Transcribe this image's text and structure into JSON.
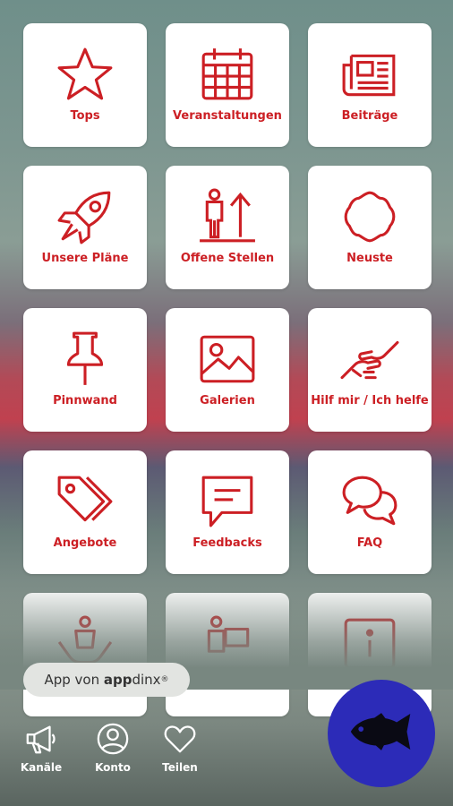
{
  "tiles": [
    {
      "label": "Tops",
      "icon": "star-icon"
    },
    {
      "label": "Veranstaltungen",
      "icon": "calendar-icon"
    },
    {
      "label": "Beiträge",
      "icon": "newspaper-icon"
    },
    {
      "label": "Unsere Pläne",
      "icon": "rocket-icon"
    },
    {
      "label": "Offene Stellen",
      "icon": "career-up-icon"
    },
    {
      "label": "Neuste",
      "icon": "flower-badge-icon"
    },
    {
      "label": "Pinnwand",
      "icon": "pushpin-icon"
    },
    {
      "label": "Galerien",
      "icon": "image-icon"
    },
    {
      "label": "Hilf mir / Ich helfe",
      "icon": "handshake-icon"
    },
    {
      "label": "Angebote",
      "icon": "tags-icon"
    },
    {
      "label": "Feedbacks",
      "icon": "message-icon"
    },
    {
      "label": "FAQ",
      "icon": "chat-bubbles-icon"
    },
    {
      "label": "",
      "icon": "child-care-icon"
    },
    {
      "label": "",
      "icon": "person-box-icon"
    },
    {
      "label": "",
      "icon": "info-icon"
    }
  ],
  "badge": {
    "prefix": "App von ",
    "brand_bold": "app",
    "brand_rest": "dinx",
    "reg": "®"
  },
  "nav": [
    {
      "label": "Kanäle",
      "icon": "megaphone-icon"
    },
    {
      "label": "Konto",
      "icon": "account-icon"
    },
    {
      "label": "Teilen",
      "icon": "heart-icon"
    }
  ],
  "fab": {
    "icon": "fish-icon"
  },
  "colors": {
    "accent": "#cc1f24",
    "fab": "#2c2bb8",
    "tile": "#ffffff"
  }
}
